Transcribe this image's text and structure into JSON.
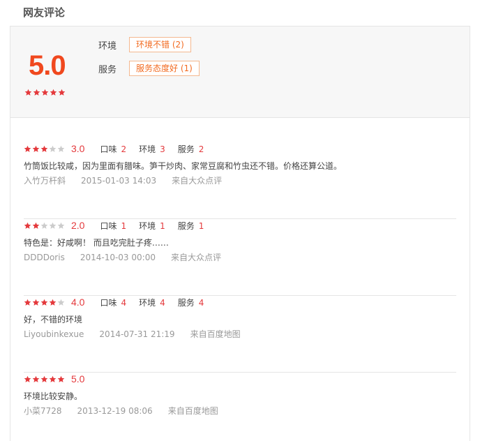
{
  "section_title": "网友评论",
  "colors": {
    "accent": "#f0481e",
    "star_on": "#e4393c",
    "star_off": "#cccccc"
  },
  "summary": {
    "score": "5.0",
    "stars": 5,
    "tags": [
      {
        "category": "环境",
        "chip": "环境不错 (2)"
      },
      {
        "category": "服务",
        "chip": "服务态度好 (1)"
      }
    ]
  },
  "sub_labels": {
    "taste": "口味",
    "env": "环境",
    "service": "服务"
  },
  "reviews": [
    {
      "stars": 3,
      "score": "3.0",
      "taste": "2",
      "env": "3",
      "service": "2",
      "content": "竹筒饭比较咸，因为里面有腊味。笋干炒肉、家常豆腐和竹虫还不错。价格还算公道。",
      "user": "入竹万杆斜",
      "time": "2015-01-03 14:03",
      "source": "来自大众点评"
    },
    {
      "stars": 2,
      "score": "2.0",
      "taste": "1",
      "env": "1",
      "service": "1",
      "content": "特色是：好咸啊！ 而且吃完肚子疼……",
      "user": "DDDDoris",
      "time": "2014-10-03 00:00",
      "source": "来自大众点评"
    },
    {
      "stars": 4,
      "score": "4.0",
      "taste": "4",
      "env": "4",
      "service": "4",
      "content": "好，不错的环境",
      "user": "Liyoubinkexue",
      "time": "2014-07-31 21:19",
      "source": "来自百度地图"
    },
    {
      "stars": 5,
      "score": "5.0",
      "taste": null,
      "env": null,
      "service": null,
      "content": "环境比较安静。",
      "user": "小菜7728",
      "time": "2013-12-19 08:06",
      "source": "来自百度地图"
    }
  ]
}
